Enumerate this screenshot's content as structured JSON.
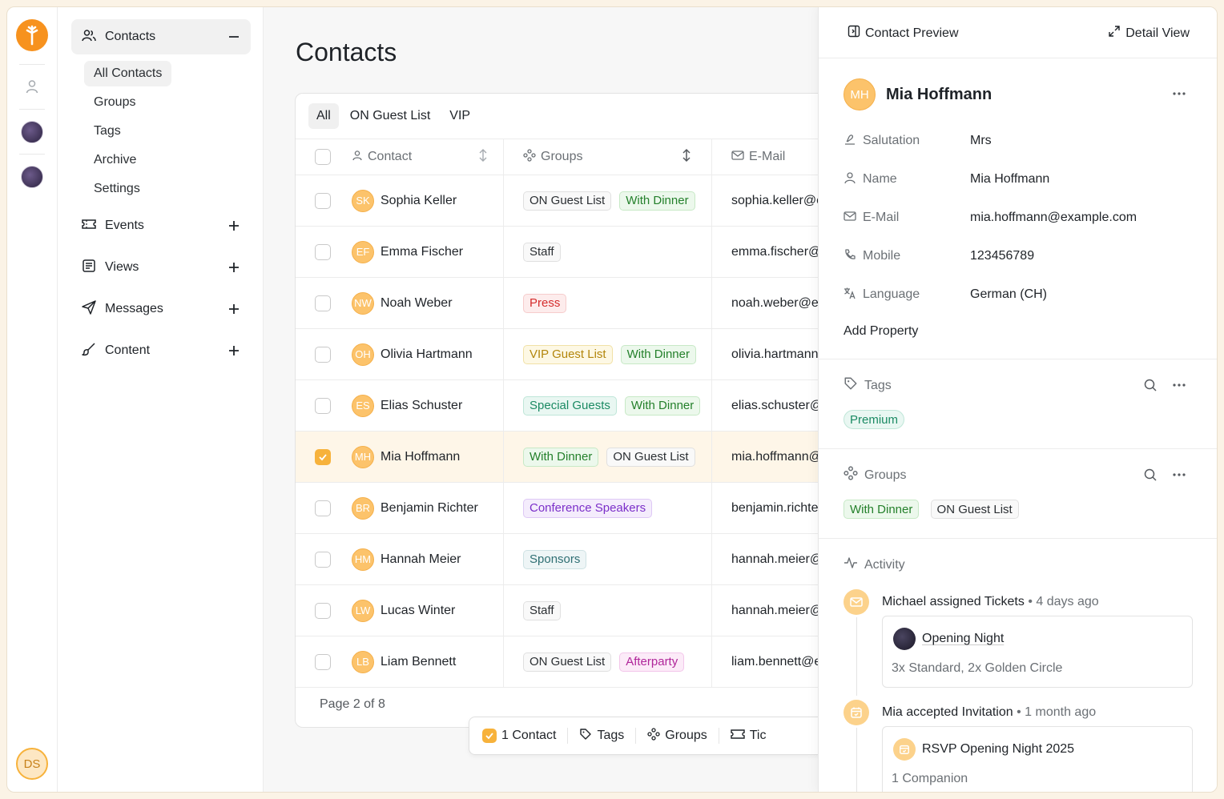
{
  "rail": {
    "user_initials": "DS"
  },
  "sidebar": {
    "contacts": "Contacts",
    "sub": [
      "All Contacts",
      "Groups",
      "Tags",
      "Archive",
      "Settings"
    ],
    "sections": [
      "Events",
      "Views",
      "Messages",
      "Content"
    ]
  },
  "main": {
    "title": "Contacts",
    "tabs": [
      "All",
      "ON Guest List",
      "VIP"
    ],
    "headers": {
      "contact": "Contact",
      "groups": "Groups",
      "email": "E-Mail"
    },
    "rows": [
      {
        "initials": "SK",
        "name": "Sophia Keller",
        "groups": [
          {
            "t": "ON Guest List",
            "c": ""
          },
          {
            "t": "With Dinner",
            "c": "b-green"
          }
        ],
        "email": "sophia.keller@e",
        "selected": false
      },
      {
        "initials": "EF",
        "name": "Emma Fischer",
        "groups": [
          {
            "t": "Staff",
            "c": ""
          }
        ],
        "email": "emma.fischer@",
        "selected": false
      },
      {
        "initials": "NW",
        "name": "Noah Weber",
        "groups": [
          {
            "t": "Press",
            "c": "b-red"
          }
        ],
        "email": "noah.weber@e:",
        "selected": false
      },
      {
        "initials": "OH",
        "name": "Olivia Hartmann",
        "groups": [
          {
            "t": "VIP Guest List",
            "c": "b-yellow"
          },
          {
            "t": "With Dinner",
            "c": "b-green"
          }
        ],
        "email": "olivia.hartmann",
        "selected": false
      },
      {
        "initials": "ES",
        "name": "Elias Schuster",
        "groups": [
          {
            "t": "Special Guests",
            "c": "b-teal"
          },
          {
            "t": "With Dinner",
            "c": "b-green"
          }
        ],
        "email": "elias.schuster@",
        "selected": false
      },
      {
        "initials": "MH",
        "name": "Mia Hoffmann",
        "groups": [
          {
            "t": "With Dinner",
            "c": "b-green"
          },
          {
            "t": "ON Guest List",
            "c": ""
          }
        ],
        "email": "mia.hoffmann@",
        "selected": true
      },
      {
        "initials": "BR",
        "name": "Benjamin Richter",
        "groups": [
          {
            "t": "Conference Speakers",
            "c": "b-purple"
          }
        ],
        "email": "benjamin.richte",
        "selected": false
      },
      {
        "initials": "HM",
        "name": "Hannah Meier",
        "groups": [
          {
            "t": "Sponsors",
            "c": "b-slate"
          }
        ],
        "email": "hannah.meier@",
        "selected": false
      },
      {
        "initials": "LW",
        "name": "Lucas Winter",
        "groups": [
          {
            "t": "Staff",
            "c": ""
          }
        ],
        "email": "hannah.meier@",
        "selected": false
      },
      {
        "initials": "LB",
        "name": "Liam Bennett",
        "groups": [
          {
            "t": "ON Guest List",
            "c": ""
          },
          {
            "t": "Afterparty",
            "c": "b-pink"
          }
        ],
        "email": "liam.bennett@e",
        "selected": false
      }
    ],
    "pager": "Page 2 of 8",
    "actionbar": {
      "count": "1 Contact",
      "tags": "Tags",
      "groups": "Groups",
      "tickets": "Tic"
    }
  },
  "panel": {
    "contact_preview": "Contact Preview",
    "detail_view": "Detail View",
    "initials": "MH",
    "name": "Mia Hoffmann",
    "props": [
      {
        "label": "Salutation",
        "value": "Mrs"
      },
      {
        "label": "Name",
        "value": "Mia Hoffmann"
      },
      {
        "label": "E-Mail",
        "value": "mia.hoffmann@example.com"
      },
      {
        "label": "Mobile",
        "value": "123456789"
      },
      {
        "label": "Language",
        "value": "German (CH)"
      }
    ],
    "add_property": "Add Property",
    "tags_title": "Tags",
    "tags": [
      "Premium"
    ],
    "groups_title": "Groups",
    "groups": [
      "With Dinner",
      "ON Guest List"
    ],
    "activity_title": "Activity",
    "activity": [
      {
        "actor": "Michael",
        "action": "assigned Tickets",
        "time": "4 days ago",
        "card_title": "Opening Night",
        "card_sub": "3x Standard, 2x Golden Circle"
      },
      {
        "actor": "Mia",
        "action": "accepted Invitation",
        "time": "1 month ago",
        "card_title": "RSVP Opening Night 2025",
        "card_sub": "1 Companion"
      }
    ]
  },
  "colors": {
    "accent": "#f7b23b",
    "brand": "#f7921e"
  }
}
